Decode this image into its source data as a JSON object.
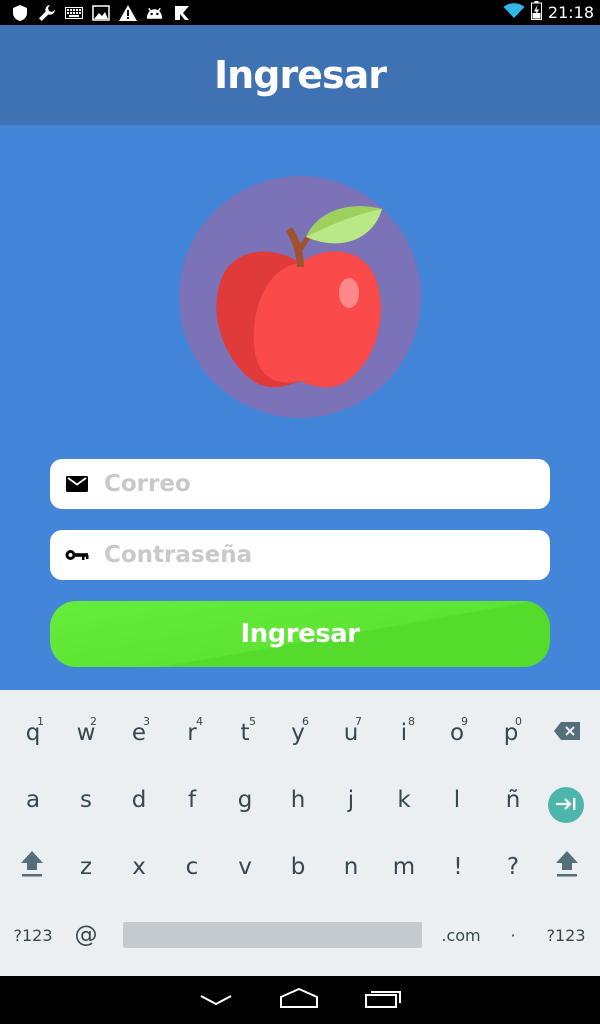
{
  "status_bar": {
    "time": "21:18",
    "left_icons": [
      "shield-icon",
      "wrench-icon",
      "keyboard-icon",
      "image-icon",
      "warning-icon",
      "android-icon",
      "store-icon"
    ],
    "right_icons": [
      "wifi-icon",
      "battery-charging-icon"
    ]
  },
  "app_bar": {
    "title": "Ingresar"
  },
  "form": {
    "email": {
      "placeholder": "Correo",
      "value": "",
      "icon": "email-icon"
    },
    "password": {
      "placeholder": "Contraseña",
      "value": "",
      "icon": "key-icon"
    },
    "submit_label": "Ingresar"
  },
  "keyboard": {
    "row1": [
      {
        "k": "q",
        "h": "1"
      },
      {
        "k": "w",
        "h": "2"
      },
      {
        "k": "e",
        "h": "3"
      },
      {
        "k": "r",
        "h": "4"
      },
      {
        "k": "t",
        "h": "5"
      },
      {
        "k": "y",
        "h": "6"
      },
      {
        "k": "u",
        "h": "7"
      },
      {
        "k": "i",
        "h": "8"
      },
      {
        "k": "o",
        "h": "9"
      },
      {
        "k": "p",
        "h": "0"
      }
    ],
    "row2": [
      "a",
      "s",
      "d",
      "f",
      "g",
      "h",
      "j",
      "k",
      "l",
      "ñ"
    ],
    "row3": [
      "z",
      "x",
      "c",
      "v",
      "b",
      "n",
      "m",
      "!",
      "?"
    ],
    "row4": {
      "symbols": "?123",
      "at": "@",
      "dotcom": ".com",
      "dot": "·",
      "symbols_right": "?123"
    }
  },
  "colors": {
    "background": "#4285d9",
    "app_bar": "#3f72b3",
    "button": "#5ee432",
    "logo_circle": "#7b72b8",
    "apple": "#f24646",
    "leaf": "#b8e986",
    "stem": "#a0522d"
  }
}
